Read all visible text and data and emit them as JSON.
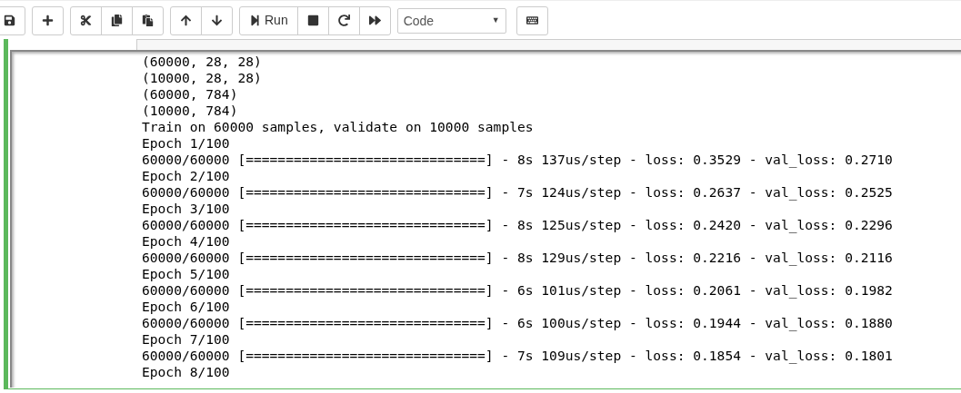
{
  "toolbar": {
    "groups": [
      {
        "buttons": [
          {
            "kind": "save"
          }
        ]
      },
      {
        "buttons": [
          {
            "kind": "add"
          }
        ]
      },
      {
        "buttons": [
          {
            "kind": "cut"
          },
          {
            "kind": "copy"
          },
          {
            "kind": "paste"
          }
        ]
      },
      {
        "buttons": [
          {
            "kind": "up"
          },
          {
            "kind": "down"
          }
        ]
      },
      {
        "buttons": [
          {
            "kind": "run",
            "label": "Run"
          },
          {
            "kind": "stop"
          },
          {
            "kind": "restart"
          },
          {
            "kind": "fast-forward"
          }
        ]
      }
    ],
    "cell_type": {
      "value": "Code",
      "caret": "▼"
    },
    "keyboard": {
      "kind": "keyboard"
    }
  },
  "output": {
    "lines": [
      "(60000, 28, 28)",
      "(10000, 28, 28)",
      "(60000, 784)",
      "(10000, 784)",
      "Train on 60000 samples, validate on 10000 samples",
      "Epoch 1/100",
      "60000/60000 [==============================] - 8s 137us/step - loss: 0.3529 - val_loss: 0.2710",
      "Epoch 2/100",
      "60000/60000 [==============================] - 7s 124us/step - loss: 0.2637 - val_loss: 0.2525",
      "Epoch 3/100",
      "60000/60000 [==============================] - 8s 125us/step - loss: 0.2420 - val_loss: 0.2296",
      "Epoch 4/100",
      "60000/60000 [==============================] - 8s 129us/step - loss: 0.2216 - val_loss: 0.2116",
      "Epoch 5/100",
      "60000/60000 [==============================] - 6s 101us/step - loss: 0.2061 - val_loss: 0.1982",
      "Epoch 6/100",
      "60000/60000 [==============================] - 6s 100us/step - loss: 0.1944 - val_loss: 0.1880",
      "Epoch 7/100",
      "60000/60000 [==============================] - 7s 109us/step - loss: 0.1854 - val_loss: 0.1801",
      "Epoch 8/100"
    ]
  }
}
